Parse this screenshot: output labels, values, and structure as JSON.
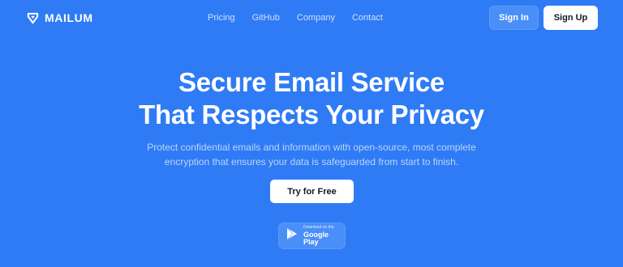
{
  "brand": {
    "name": "MAILUM",
    "icon": "shield-logo-icon"
  },
  "nav": {
    "links": [
      "Pricing",
      "GitHub",
      "Company",
      "Contact"
    ],
    "signin_label": "Sign In",
    "signup_label": "Sign Up"
  },
  "hero": {
    "title_line1": "Secure Email Service",
    "title_line2": "That Respects Your Privacy",
    "subtitle_line1": "Protect confidential emails and information with open-source, most complete",
    "subtitle_line2": "encryption that ensures your data is safeguarded from start to finish.",
    "cta_label": "Try for Free"
  },
  "store": {
    "small_text": "Download on the",
    "big_text": "Google Play",
    "icon": "play-icon"
  },
  "colors": {
    "background": "#2f7bf5",
    "button_light": "#ffffff",
    "button_tint": "#4a8ff8"
  }
}
